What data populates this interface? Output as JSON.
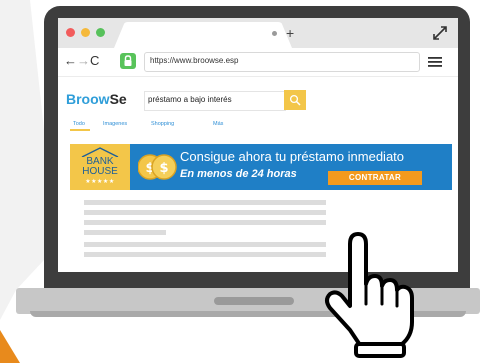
{
  "colors": {
    "accent_blue": "#1f7fc6",
    "brand_blue": "#2f9ed9",
    "yellow": "#f3c649",
    "cta_orange": "#f39a1e",
    "lock_green": "#58c35a"
  },
  "browser": {
    "url": "https://www.broowse.esp",
    "new_tab_symbol": "+",
    "nav": {
      "back": "←",
      "forward": "→",
      "reload": "C"
    }
  },
  "search": {
    "brand_part1": "Broow",
    "brand_part2": "Se",
    "query": "préstamo a bajo interés",
    "tabs": [
      "Todo",
      "Imagenes",
      "Shopping",
      "Más"
    ]
  },
  "ad": {
    "logo_line1": "BANK",
    "logo_line2": "HOUSE",
    "stars": "★★★★★",
    "headline": "Consigue ahora tu préstamo inmediato",
    "subline": "En menos de 24 horas",
    "cta": "CONTRATAR"
  },
  "icons": [
    "lock-icon",
    "menu-icon",
    "expand-icon",
    "search-icon",
    "coin-icon",
    "hand-cursor-icon"
  ]
}
